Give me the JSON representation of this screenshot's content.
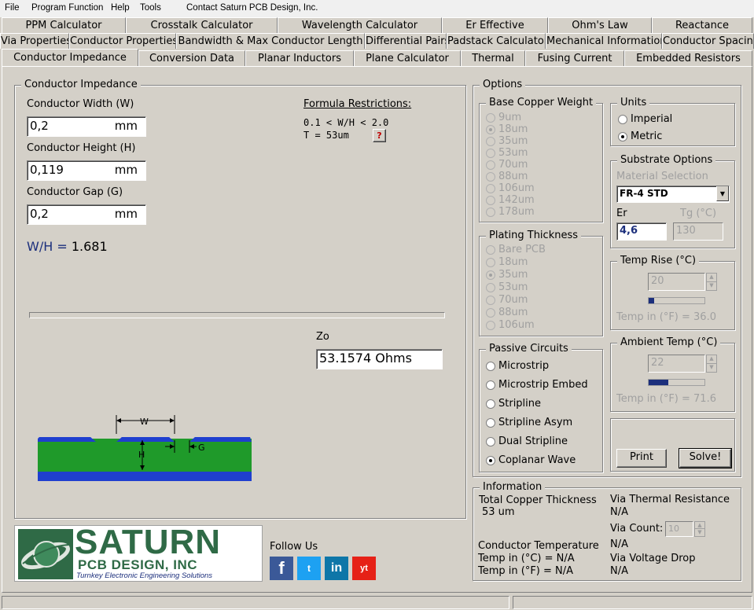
{
  "menubar": {
    "items": [
      "File",
      "Program Function",
      "Help",
      "Tools",
      "Contact Saturn PCB Design, Inc."
    ]
  },
  "tabs": {
    "row1": [
      "PPM Calculator",
      "Crosstalk Calculator",
      "Wavelength Calculator",
      "Er Effective",
      "Ohm's Law",
      "Reactance"
    ],
    "row2": [
      "Via Properties",
      "Conductor Properties",
      "Bandwidth & Max Conductor Length",
      "Differential Pairs",
      "Padstack Calculator",
      "Mechanical Information",
      "Conductor Spacing"
    ],
    "row3": [
      "Conductor Impedance",
      "Conversion Data",
      "Planar Inductors",
      "Plane Calculator",
      "Thermal",
      "Fusing Current",
      "Embedded Resistors"
    ]
  },
  "impedance": {
    "title": "Conductor Impedance",
    "width_label": "Conductor Width (W)",
    "width_value": "0,2",
    "height_label": "Conductor Height (H)",
    "height_value": "0,119",
    "gap_label": "Conductor Gap (G)",
    "gap_value": "0,2",
    "unit": "mm",
    "wh_label": "W/H =",
    "wh_value": "1.681",
    "restrictions_title": "Formula Restrictions:",
    "restriction_1": "0.1 < W/H < 2.0",
    "restriction_2": "T = 53um",
    "help_glyph": "?",
    "zo_label": "Zo",
    "zo_value": "53.1574 Ohms",
    "diagram": {
      "w": "W",
      "h": "H",
      "g": "G"
    }
  },
  "options": {
    "title": "Options",
    "base_copper": {
      "title": "Base Copper Weight",
      "items": [
        "9um",
        "18um",
        "35um",
        "53um",
        "70um",
        "88um",
        "106um",
        "142um",
        "178um"
      ],
      "selected": 1
    },
    "plating": {
      "title": "Plating Thickness",
      "items": [
        "Bare PCB",
        "18um",
        "35um",
        "53um",
        "70um",
        "88um",
        "106um"
      ],
      "selected": 2
    },
    "passive": {
      "title": "Passive Circuits",
      "items": [
        "Microstrip",
        "Microstrip Embed",
        "Stripline",
        "Stripline Asym",
        "Dual Stripline",
        "Coplanar Wave"
      ],
      "selected": 5
    },
    "units": {
      "title": "Units",
      "items": [
        "Imperial",
        "Metric"
      ],
      "selected": 1
    },
    "substrate": {
      "title": "Substrate Options",
      "material_label": "Material Selection",
      "material_value": "FR-4 STD",
      "er_label": "Er",
      "er_value": "4,6",
      "tg_label": "Tg (°C)",
      "tg_value": "130"
    },
    "temp_rise": {
      "title": "Temp Rise (°C)",
      "value": "20",
      "level": 0.1,
      "readout": "Temp in (°F) = 36.0"
    },
    "ambient": {
      "title": "Ambient Temp (°C)",
      "value": "22",
      "level": 0.35,
      "readout": "Temp in (°F) = 71.6"
    },
    "print_label": "Print",
    "solve_label": "Solve!"
  },
  "info": {
    "title": "Information",
    "copper_label": "Total Copper Thickness",
    "copper_value": "53 um",
    "cond_temp_label": "Conductor Temperature",
    "temp_c": "Temp in (°C) = N/A",
    "temp_f": "Temp in (°F) = N/A",
    "via_res_label": "Via Thermal Resistance",
    "via_res_value": "N/A",
    "via_count_label": "Via Count:",
    "via_count_value": "10",
    "cond_temp_value": "N/A",
    "via_drop_label": "Via Voltage Drop",
    "via_drop_value": "N/A"
  },
  "branding": {
    "logo_main": "SATURN",
    "logo_sub": "PCB DESIGN, INC",
    "logo_tagline": "Turnkey Electronic Engineering Solutions",
    "follow": "Follow Us",
    "social": [
      "f",
      "t",
      "in",
      "yt"
    ]
  },
  "colors": {
    "copper": "#1f3fcf",
    "substrate": "#1f9a2a",
    "logo_green": "#2f6a46",
    "navy": "#1c2f7c"
  }
}
